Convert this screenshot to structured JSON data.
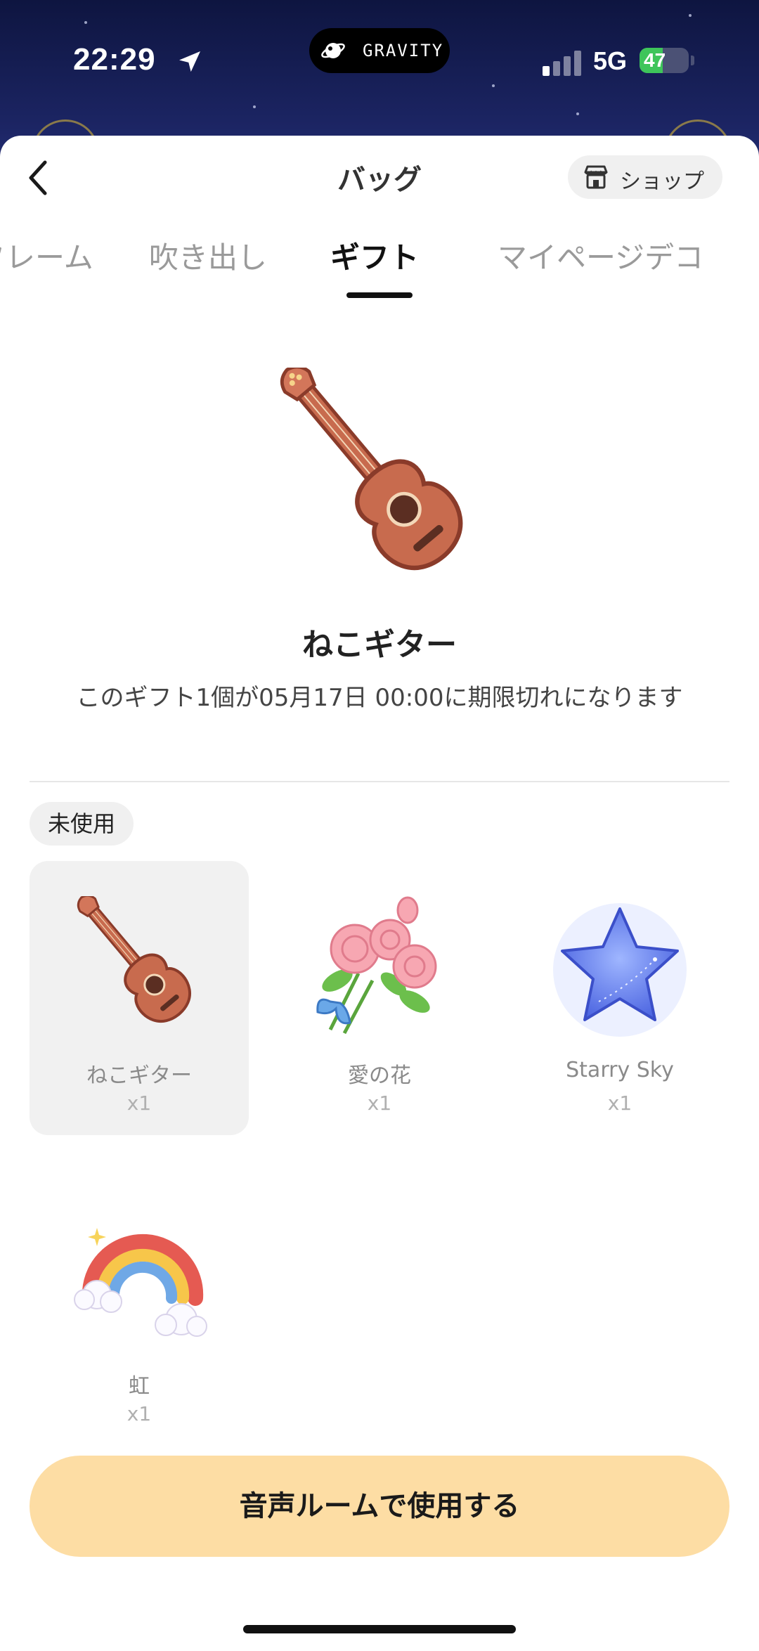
{
  "status_bar": {
    "time": "22:29",
    "network": "5G",
    "battery": "47",
    "battery_level": 0.47,
    "island_brand": "GRAVITY"
  },
  "header": {
    "title": "バッグ",
    "shop_label": "ショップ",
    "back_icon": "chevron-left-icon",
    "shop_icon": "store-icon"
  },
  "tabs": [
    {
      "label": "フレーム",
      "active": false
    },
    {
      "label": "吹き出し",
      "active": false
    },
    {
      "label": "ギフト",
      "active": true
    },
    {
      "label": "マイページデコ",
      "active": false
    }
  ],
  "selected_gift": {
    "name": "ねこギター",
    "expiry_text": "このギフト1個が05月17日 00:00に期限切れになります"
  },
  "section_label": "未使用",
  "gifts": [
    {
      "name": "ねこギター",
      "qty": "x1",
      "icon": "guitar-icon",
      "selected": true
    },
    {
      "name": "愛の花",
      "qty": "x1",
      "icon": "rose-bouquet-icon",
      "selected": false
    },
    {
      "name": "Starry Sky",
      "qty": "x1",
      "icon": "star-icon",
      "selected": false
    },
    {
      "name": "虹",
      "qty": "x1",
      "icon": "rainbow-icon",
      "selected": false
    }
  ],
  "cta_label": "音声ルームで使用する",
  "colors": {
    "cta_bg": "#fddda4",
    "selected_card_bg": "#f1f1f1",
    "sky": "#1c2564",
    "battery_green": "#3ec55a"
  }
}
